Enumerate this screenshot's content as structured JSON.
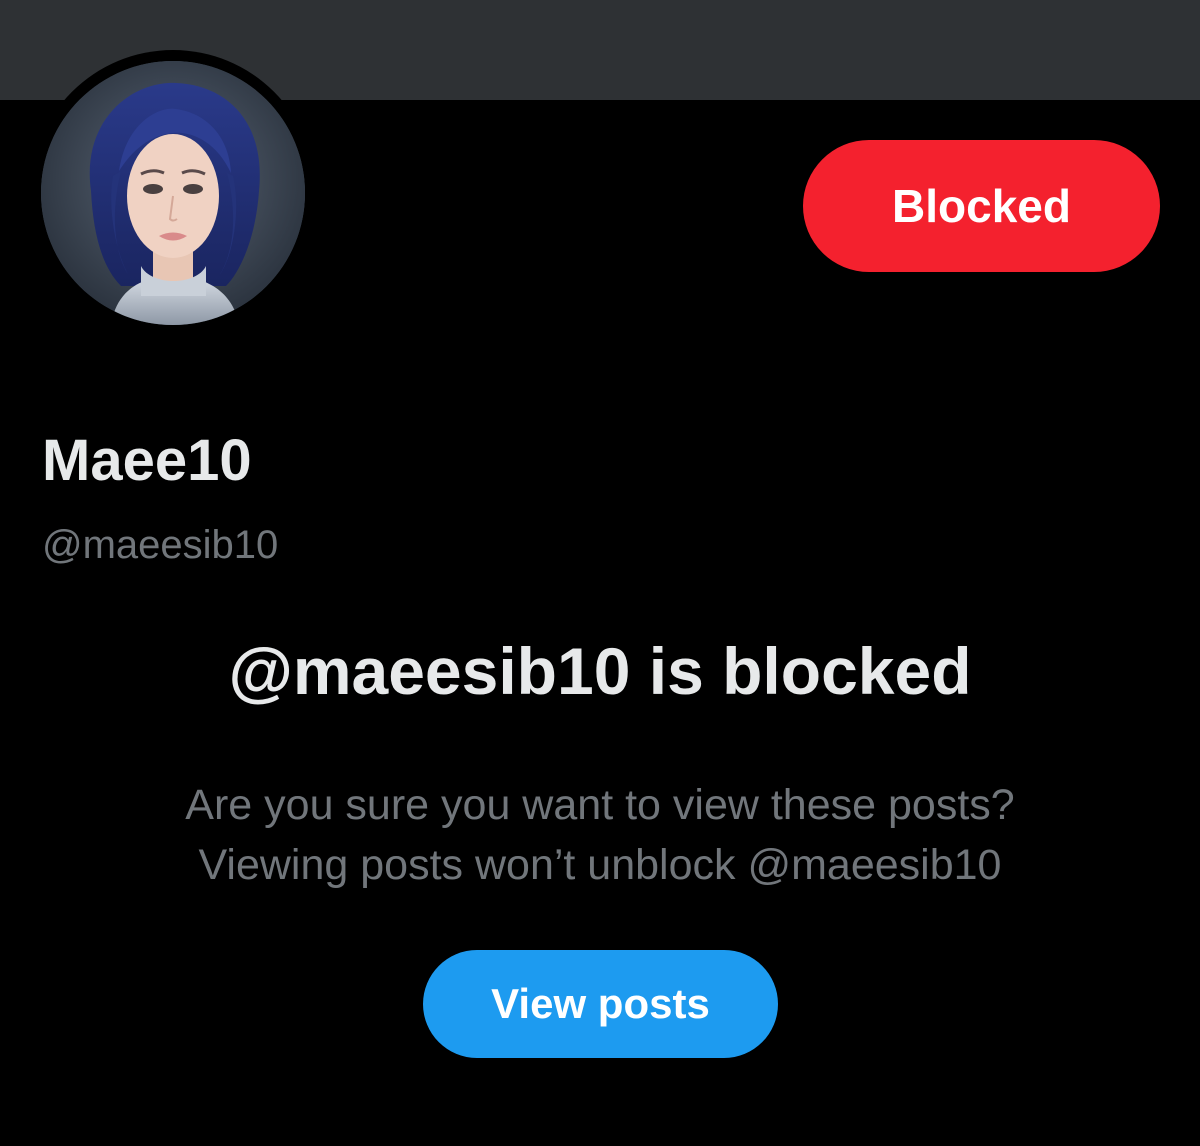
{
  "profile": {
    "display_name": "Maee10",
    "handle": "@maeesib10",
    "avatar_icon": "avatar-icon"
  },
  "header": {
    "blocked_button_label": "Blocked"
  },
  "notice": {
    "title": "@maeesib10 is blocked",
    "line1": "Are you sure you want to view these posts?",
    "line2": "Viewing posts won’t unblock @maeesib10",
    "view_button_label": "View posts"
  },
  "colors": {
    "background": "#000000",
    "banner": "#2e3134",
    "blocked_button": "#f4212e",
    "view_button": "#1d9bf0",
    "primary_text": "#e7e9ea",
    "secondary_text": "#71767b"
  }
}
